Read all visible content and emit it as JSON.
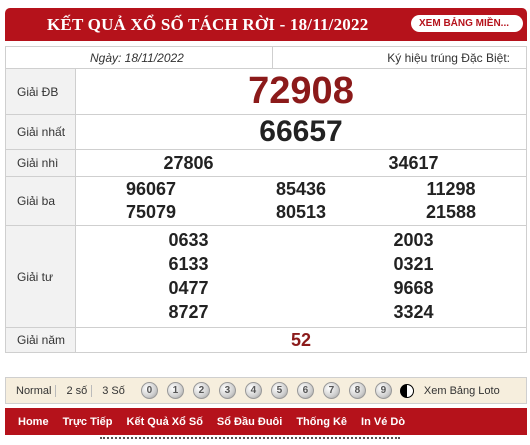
{
  "header": {
    "title": "KẾT QUẢ XỔ SỐ TÁCH RỜI - 18/11/2022",
    "link": "XEM BẢNG MIỀN..."
  },
  "info": {
    "date": "Ngày: 18/11/2022",
    "code_label": "Ký hiệu trúng Đặc Biệt:"
  },
  "prizes": {
    "db": {
      "label": "Giải ĐB",
      "number": "72908"
    },
    "nhat": {
      "label": "Giải nhất",
      "number": "66657"
    },
    "nhi": {
      "label": "Giải nhì",
      "numbers": [
        "27806",
        "34617"
      ]
    },
    "ba": {
      "label": "Giải ba",
      "numbers": [
        "96067",
        "85436",
        "11298",
        "75079",
        "80513",
        "21588"
      ]
    },
    "tu": {
      "label": "Giải tư",
      "numbers": [
        "0633",
        "2003",
        "6133",
        "0321",
        "0477",
        "9668",
        "8727",
        "3324"
      ]
    },
    "nam": {
      "label": "Giải năm",
      "number": "52"
    }
  },
  "toolbar": {
    "modes": [
      "Normal",
      "2 số",
      "3 Số"
    ],
    "digits": [
      "0",
      "1",
      "2",
      "3",
      "4",
      "5",
      "6",
      "7",
      "8",
      "9"
    ],
    "loto_link": "Xem Bảng Loto"
  },
  "nav": {
    "items": [
      "Home",
      "Trực Tiếp",
      "Kết Quả Xổ Số",
      "Sổ Đầu Đuôi",
      "Thống Kê",
      "In Vé Dò"
    ]
  },
  "colors": {
    "brand_red": "#b5121b",
    "special_prize": "#8b1a1a"
  }
}
